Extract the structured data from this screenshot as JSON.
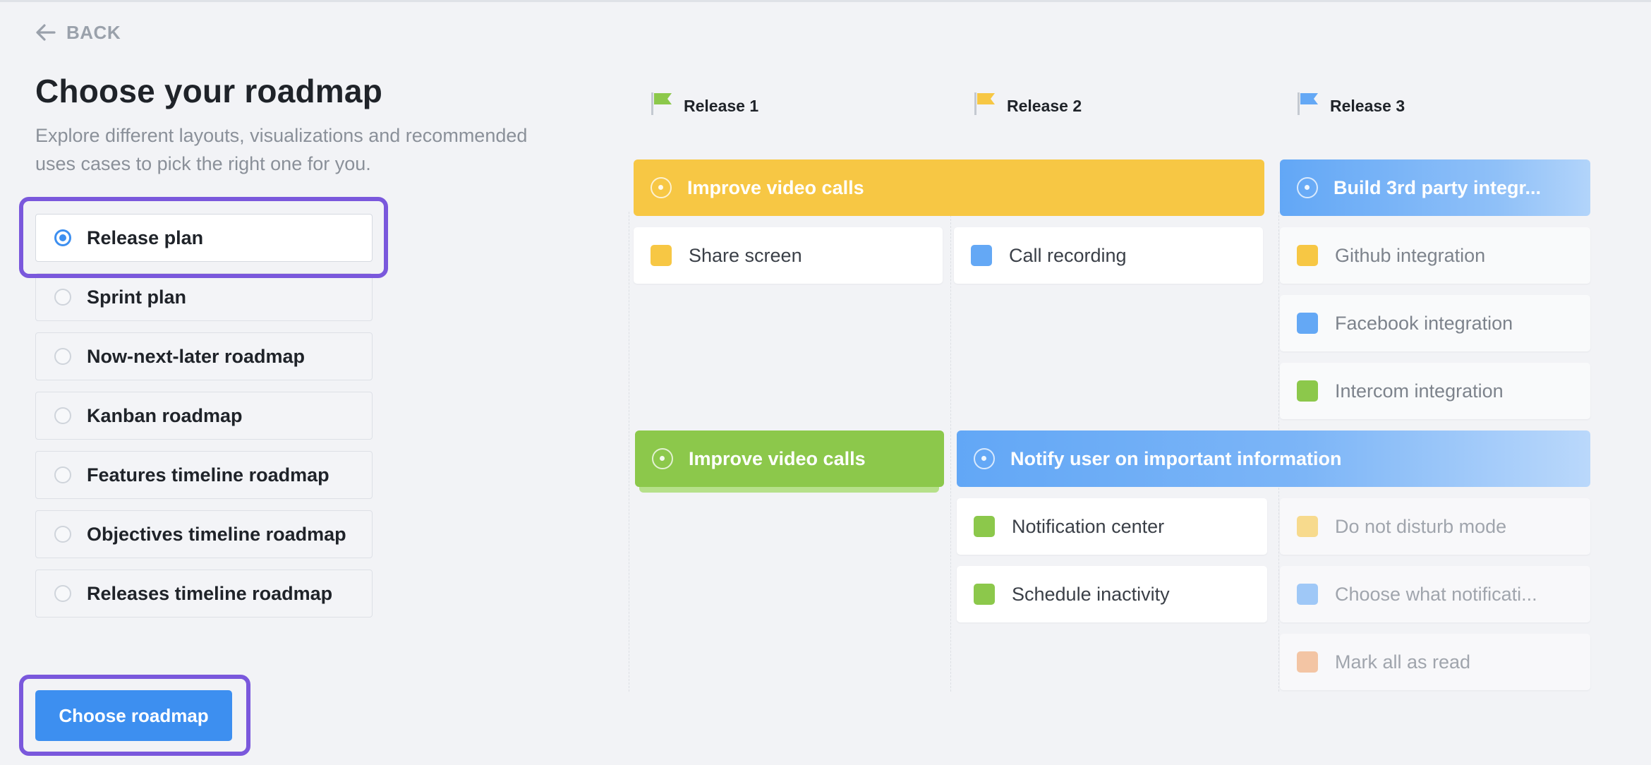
{
  "back_label": "BACK",
  "title": "Choose your roadmap",
  "subtitle": "Explore different layouts, visualizations and recommended uses cases to pick the right one for you.",
  "options": [
    {
      "label": "Release plan",
      "selected": true
    },
    {
      "label": "Sprint plan",
      "selected": false
    },
    {
      "label": "Now-next-later roadmap",
      "selected": false
    },
    {
      "label": "Kanban roadmap",
      "selected": false
    },
    {
      "label": "Features timeline roadmap",
      "selected": false
    },
    {
      "label": "Objectives timeline roadmap",
      "selected": false
    },
    {
      "label": "Releases timeline roadmap",
      "selected": false
    }
  ],
  "cta_label": "Choose roadmap",
  "colors": {
    "accent": "#3d8ff0",
    "highlight": "#7a58dc",
    "yellow": "#f7c744",
    "green": "#8cc84b",
    "blue": "#64a8f5",
    "orange": "#f0a36b"
  },
  "board": {
    "releases": [
      {
        "label": "Release 1",
        "flag_color": "#8cc84b"
      },
      {
        "label": "Release 2",
        "flag_color": "#f7c744"
      },
      {
        "label": "Release 3",
        "flag_color": "#64a8f5"
      }
    ],
    "epics": [
      {
        "label": "Improve video calls",
        "color": "yellow",
        "icon": "target-icon"
      },
      {
        "label": "Build 3rd party integr...",
        "color": "blue",
        "icon": "target-icon"
      },
      {
        "label": "Improve video calls",
        "color": "green",
        "icon": "target-icon"
      },
      {
        "label": "Notify user on important information",
        "color": "blue",
        "icon": "target-icon"
      }
    ],
    "cards": [
      {
        "label": "Share screen",
        "color": "#f7c744"
      },
      {
        "label": "Call recording",
        "color": "#64a8f5"
      },
      {
        "label": "Github integration",
        "color": "#f7c744"
      },
      {
        "label": "Facebook integration",
        "color": "#64a8f5"
      },
      {
        "label": "Intercom integration",
        "color": "#8cc84b"
      },
      {
        "label": "Notification center",
        "color": "#8cc84b"
      },
      {
        "label": "Schedule inactivity",
        "color": "#8cc84b"
      },
      {
        "label": "Do not disturb mode",
        "color": "#f7c744"
      },
      {
        "label": "Choose what notificati...",
        "color": "#64a8f5"
      },
      {
        "label": "Mark all as read",
        "color": "#f0a36b"
      }
    ]
  }
}
